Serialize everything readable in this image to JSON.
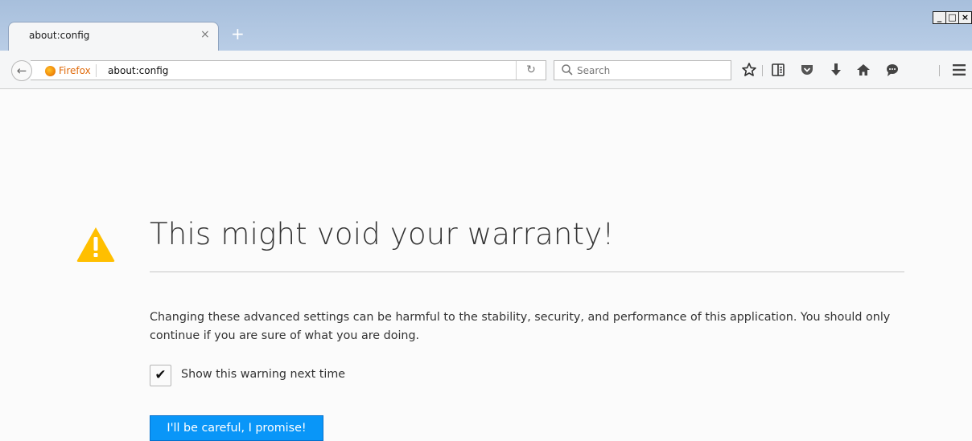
{
  "tabs": [
    {
      "title": "about:config",
      "close_glyph": "×"
    }
  ],
  "new_tab_glyph": "+",
  "window_controls": {
    "minimize": "_",
    "maximize": "□",
    "close": "×"
  },
  "navbar": {
    "back_glyph": "←",
    "identity_label": "Firefox",
    "url": "about:config",
    "reload_glyph": "↻",
    "search_placeholder": "Search",
    "toolbar_icons": [
      "bookmark-star-icon",
      "reading-list-icon",
      "pocket-icon",
      "downloads-icon",
      "home-icon",
      "hello-icon",
      "menu-icon"
    ]
  },
  "content": {
    "title": "This might void your warranty!",
    "description": "Changing these advanced settings can be harmful to the stability, security, and performance of this application. You should only continue if you are sure of what you are doing.",
    "checkbox_checked": true,
    "checkbox_glyph": "✔",
    "checkbox_label": "Show this warning next time",
    "button_label": "I'll be careful, I promise!"
  },
  "colors": {
    "accent": "#0996f8",
    "warning": "#ffbf00",
    "firefox_label": "#e06b0d"
  }
}
